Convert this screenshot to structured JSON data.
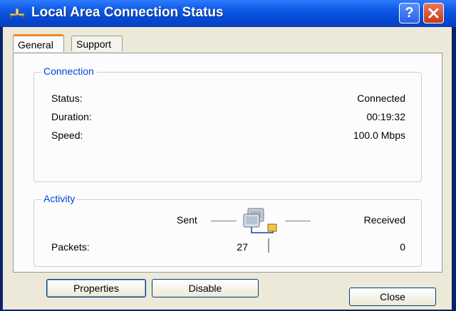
{
  "window": {
    "title": "Local Area Connection Status",
    "help_label": "?"
  },
  "tabs": [
    {
      "label": "General",
      "active": true
    },
    {
      "label": "Support",
      "active": false
    }
  ],
  "connection": {
    "legend": "Connection",
    "rows": [
      {
        "label": "Status:",
        "value": "Connected"
      },
      {
        "label": "Duration:",
        "value": "00:19:32"
      },
      {
        "label": "Speed:",
        "value": "100.0 Mbps"
      }
    ]
  },
  "activity": {
    "legend": "Activity",
    "sent_label": "Sent",
    "received_label": "Received",
    "packets_label": "Packets:",
    "packets_sent": "27",
    "packets_received": "0",
    "icon": "network-computers-icon"
  },
  "buttons": {
    "properties": "Properties",
    "disable": "Disable",
    "close": "Close"
  },
  "colors": {
    "titlebar": "#0548d6",
    "legend_text": "#0046d5",
    "close_button": "#c93a16",
    "tab_highlight": "#e68b2c"
  }
}
